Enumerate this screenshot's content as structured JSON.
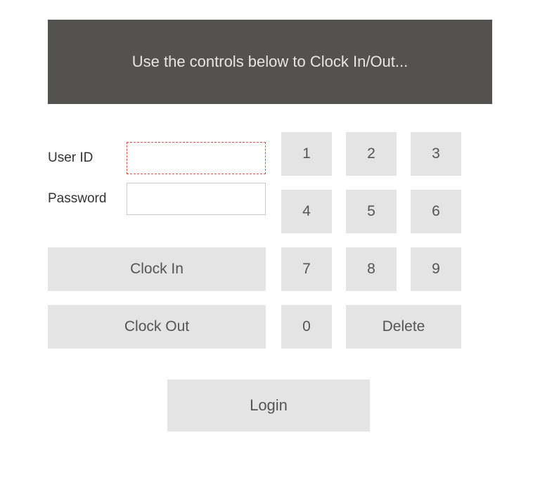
{
  "header": {
    "title": "Use the controls below to Clock In/Out..."
  },
  "fields": {
    "userid": {
      "label": "User ID",
      "value": ""
    },
    "password": {
      "label": "Password",
      "value": ""
    }
  },
  "keypad": {
    "keys": [
      "1",
      "2",
      "3",
      "4",
      "5",
      "6",
      "7",
      "8",
      "9",
      "0"
    ],
    "delete_label": "Delete"
  },
  "actions": {
    "clock_in": "Clock In",
    "clock_out": "Clock Out",
    "login": "Login"
  }
}
